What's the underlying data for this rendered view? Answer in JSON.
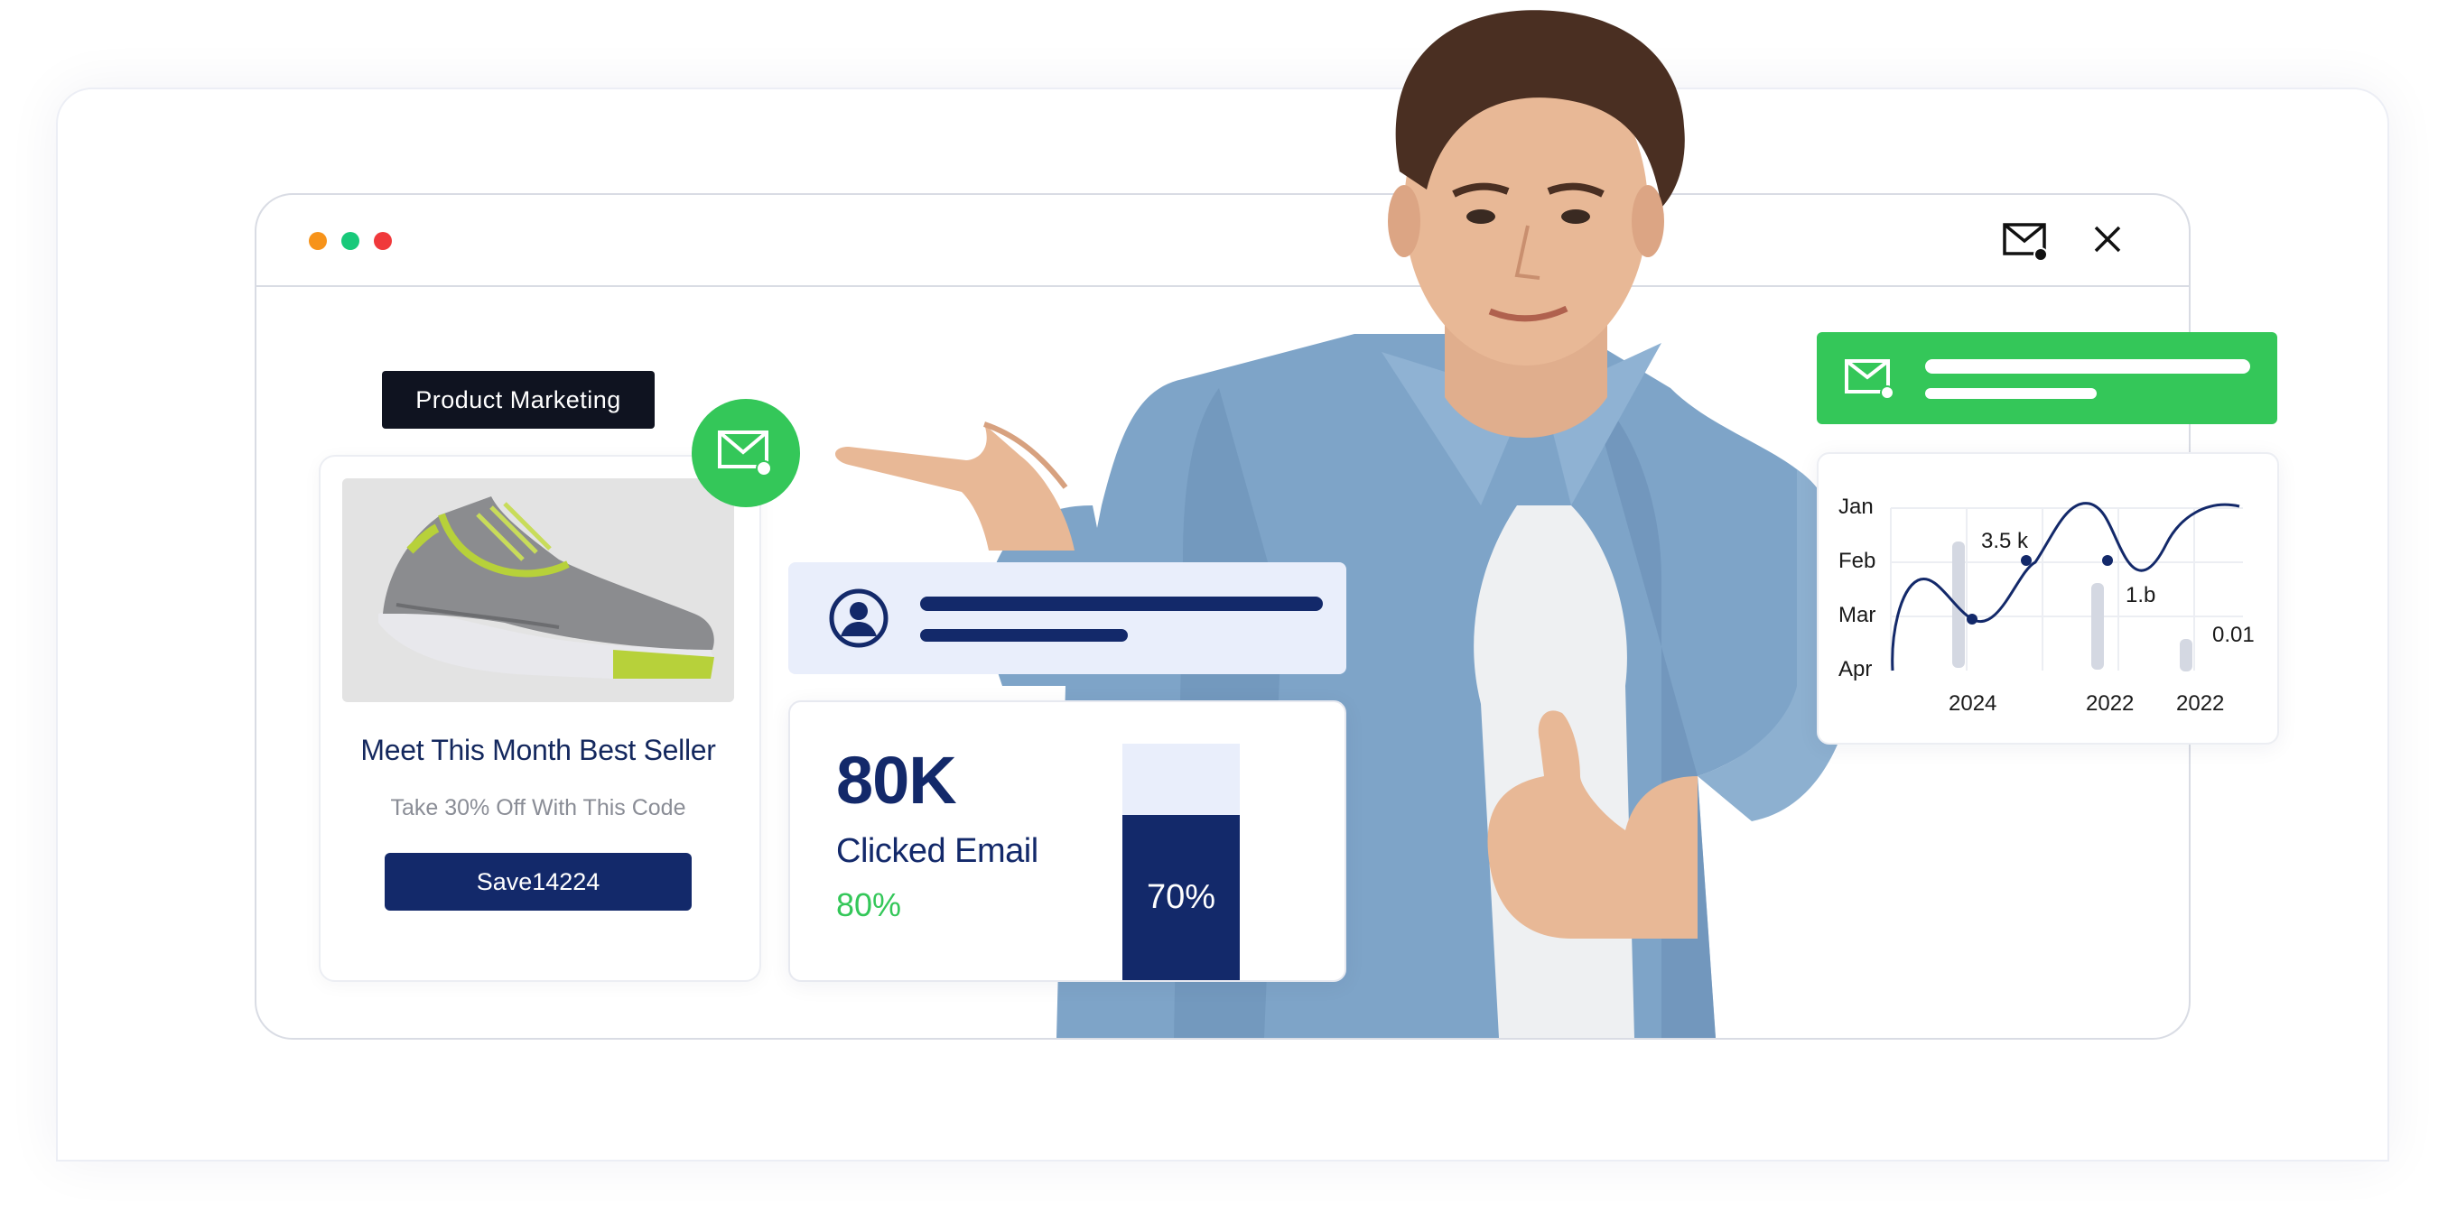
{
  "window": {
    "controls": [
      "orange-dot",
      "green-dot",
      "red-dot"
    ],
    "icons": [
      "mail-icon",
      "close-icon"
    ]
  },
  "product_card": {
    "tag": "Product Marketing",
    "image_icon": "sneaker-image",
    "title": "Meet This Month Best Seller",
    "subtitle": "Take 30% Off With This Code",
    "code_button": "Save14224",
    "badge_icon": "mail-icon"
  },
  "user_panel": {
    "icon": "user-avatar-icon"
  },
  "stats": {
    "value": "80K",
    "label": "Clicked Email",
    "percent": "80%",
    "progress_label": "70%",
    "progress_fraction": 0.7
  },
  "notification": {
    "icon": "mail-icon"
  },
  "chart_data": {
    "type": "line",
    "y_tick_labels": [
      "Jan",
      "Feb",
      "Mar",
      "Apr"
    ],
    "x_tick_labels": [
      "2024",
      "2022",
      "2022"
    ],
    "annotations": [
      "3.5 k",
      "1.b",
      "0.01"
    ]
  },
  "colors": {
    "navy": "#13296a",
    "green": "#34c759",
    "light_blue": "#e9eefb",
    "dark": "#0f1320"
  }
}
